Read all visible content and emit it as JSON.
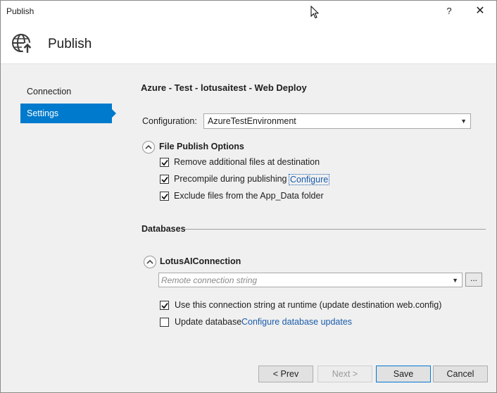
{
  "window": {
    "title": "Publish",
    "help_label": "?",
    "close_label": "✕"
  },
  "header": {
    "title": "Publish"
  },
  "nav": {
    "items": [
      {
        "label": "Connection"
      },
      {
        "label": "Settings",
        "selected": true
      }
    ]
  },
  "profile": {
    "title": "Azure - Test - lotusaitest - Web Deploy"
  },
  "configuration": {
    "label": "Configuration:",
    "value": "AzureTestEnvironment"
  },
  "file_publish": {
    "title": "File Publish Options",
    "options": [
      {
        "label": "Remove additional files at destination",
        "checked": true
      },
      {
        "label": "Precompile during publishing",
        "checked": true,
        "link": "Configure"
      },
      {
        "label": "Exclude files from the App_Data folder",
        "checked": true
      }
    ]
  },
  "databases": {
    "title": "Databases",
    "connection": {
      "name": "LotusAIConnection",
      "placeholder": "Remote connection string",
      "browse_label": "...",
      "use_at_runtime": {
        "label": "Use this connection string at runtime (update destination web.config)",
        "checked": true
      },
      "update_database": {
        "label": "Update database",
        "checked": false,
        "link": "Configure database updates"
      }
    }
  },
  "buttons": {
    "prev": "< Prev",
    "next": "Next >",
    "save": "Save",
    "cancel": "Cancel"
  },
  "colors": {
    "accent": "#007acc",
    "link": "#1a5cab"
  }
}
